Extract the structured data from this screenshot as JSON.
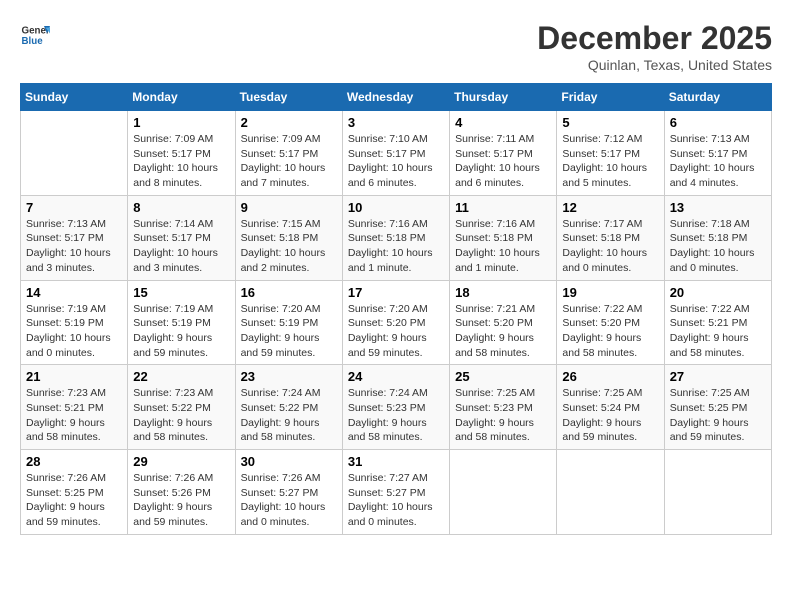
{
  "header": {
    "logo_line1": "General",
    "logo_line2": "Blue",
    "month": "December 2025",
    "location": "Quinlan, Texas, United States"
  },
  "days_of_week": [
    "Sunday",
    "Monday",
    "Tuesday",
    "Wednesday",
    "Thursday",
    "Friday",
    "Saturday"
  ],
  "weeks": [
    [
      {
        "day": "",
        "info": ""
      },
      {
        "day": "1",
        "info": "Sunrise: 7:09 AM\nSunset: 5:17 PM\nDaylight: 10 hours\nand 8 minutes."
      },
      {
        "day": "2",
        "info": "Sunrise: 7:09 AM\nSunset: 5:17 PM\nDaylight: 10 hours\nand 7 minutes."
      },
      {
        "day": "3",
        "info": "Sunrise: 7:10 AM\nSunset: 5:17 PM\nDaylight: 10 hours\nand 6 minutes."
      },
      {
        "day": "4",
        "info": "Sunrise: 7:11 AM\nSunset: 5:17 PM\nDaylight: 10 hours\nand 6 minutes."
      },
      {
        "day": "5",
        "info": "Sunrise: 7:12 AM\nSunset: 5:17 PM\nDaylight: 10 hours\nand 5 minutes."
      },
      {
        "day": "6",
        "info": "Sunrise: 7:13 AM\nSunset: 5:17 PM\nDaylight: 10 hours\nand 4 minutes."
      }
    ],
    [
      {
        "day": "7",
        "info": "Sunrise: 7:13 AM\nSunset: 5:17 PM\nDaylight: 10 hours\nand 3 minutes."
      },
      {
        "day": "8",
        "info": "Sunrise: 7:14 AM\nSunset: 5:17 PM\nDaylight: 10 hours\nand 3 minutes."
      },
      {
        "day": "9",
        "info": "Sunrise: 7:15 AM\nSunset: 5:18 PM\nDaylight: 10 hours\nand 2 minutes."
      },
      {
        "day": "10",
        "info": "Sunrise: 7:16 AM\nSunset: 5:18 PM\nDaylight: 10 hours\nand 1 minute."
      },
      {
        "day": "11",
        "info": "Sunrise: 7:16 AM\nSunset: 5:18 PM\nDaylight: 10 hours\nand 1 minute."
      },
      {
        "day": "12",
        "info": "Sunrise: 7:17 AM\nSunset: 5:18 PM\nDaylight: 10 hours\nand 0 minutes."
      },
      {
        "day": "13",
        "info": "Sunrise: 7:18 AM\nSunset: 5:18 PM\nDaylight: 10 hours\nand 0 minutes."
      }
    ],
    [
      {
        "day": "14",
        "info": "Sunrise: 7:19 AM\nSunset: 5:19 PM\nDaylight: 10 hours\nand 0 minutes."
      },
      {
        "day": "15",
        "info": "Sunrise: 7:19 AM\nSunset: 5:19 PM\nDaylight: 9 hours\nand 59 minutes."
      },
      {
        "day": "16",
        "info": "Sunrise: 7:20 AM\nSunset: 5:19 PM\nDaylight: 9 hours\nand 59 minutes."
      },
      {
        "day": "17",
        "info": "Sunrise: 7:20 AM\nSunset: 5:20 PM\nDaylight: 9 hours\nand 59 minutes."
      },
      {
        "day": "18",
        "info": "Sunrise: 7:21 AM\nSunset: 5:20 PM\nDaylight: 9 hours\nand 58 minutes."
      },
      {
        "day": "19",
        "info": "Sunrise: 7:22 AM\nSunset: 5:20 PM\nDaylight: 9 hours\nand 58 minutes."
      },
      {
        "day": "20",
        "info": "Sunrise: 7:22 AM\nSunset: 5:21 PM\nDaylight: 9 hours\nand 58 minutes."
      }
    ],
    [
      {
        "day": "21",
        "info": "Sunrise: 7:23 AM\nSunset: 5:21 PM\nDaylight: 9 hours\nand 58 minutes."
      },
      {
        "day": "22",
        "info": "Sunrise: 7:23 AM\nSunset: 5:22 PM\nDaylight: 9 hours\nand 58 minutes."
      },
      {
        "day": "23",
        "info": "Sunrise: 7:24 AM\nSunset: 5:22 PM\nDaylight: 9 hours\nand 58 minutes."
      },
      {
        "day": "24",
        "info": "Sunrise: 7:24 AM\nSunset: 5:23 PM\nDaylight: 9 hours\nand 58 minutes."
      },
      {
        "day": "25",
        "info": "Sunrise: 7:25 AM\nSunset: 5:23 PM\nDaylight: 9 hours\nand 58 minutes."
      },
      {
        "day": "26",
        "info": "Sunrise: 7:25 AM\nSunset: 5:24 PM\nDaylight: 9 hours\nand 59 minutes."
      },
      {
        "day": "27",
        "info": "Sunrise: 7:25 AM\nSunset: 5:25 PM\nDaylight: 9 hours\nand 59 minutes."
      }
    ],
    [
      {
        "day": "28",
        "info": "Sunrise: 7:26 AM\nSunset: 5:25 PM\nDaylight: 9 hours\nand 59 minutes."
      },
      {
        "day": "29",
        "info": "Sunrise: 7:26 AM\nSunset: 5:26 PM\nDaylight: 9 hours\nand 59 minutes."
      },
      {
        "day": "30",
        "info": "Sunrise: 7:26 AM\nSunset: 5:27 PM\nDaylight: 10 hours\nand 0 minutes."
      },
      {
        "day": "31",
        "info": "Sunrise: 7:27 AM\nSunset: 5:27 PM\nDaylight: 10 hours\nand 0 minutes."
      },
      {
        "day": "",
        "info": ""
      },
      {
        "day": "",
        "info": ""
      },
      {
        "day": "",
        "info": ""
      }
    ]
  ]
}
